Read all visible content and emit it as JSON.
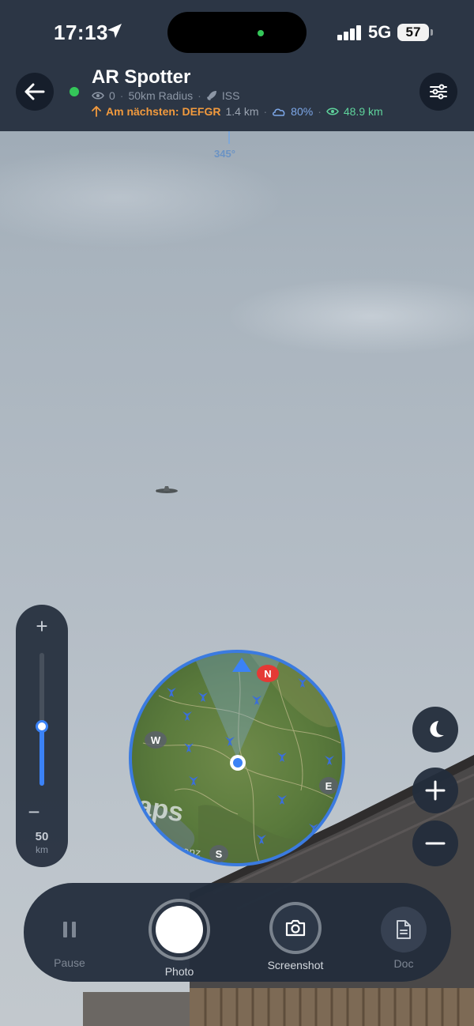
{
  "status_bar": {
    "time": "17:13",
    "network": "5G",
    "battery": "57"
  },
  "header": {
    "title": "AR Spotter",
    "viewer_count": "0",
    "radius": "50km Radius",
    "satellite": "ISS",
    "nearest_label": "Am nächsten: DEFGR",
    "nearest_distance": "1.4 km",
    "cloud_cover": "80%",
    "visibility": "48.9 km",
    "heading": "345°"
  },
  "zoom": {
    "plus": "+",
    "minus": "−",
    "value": "50",
    "unit": "km",
    "level": 0.45
  },
  "map": {
    "north": "N",
    "west": "W",
    "east": "E",
    "south": "S",
    "watermark": "aps",
    "place": "regenz"
  },
  "toolbar": {
    "pause_label": "Pause",
    "photo_label": "Photo",
    "screenshot_label": "Screenshot",
    "doc_label": "Doc"
  },
  "colors": {
    "accent": "#3b82f6",
    "nearest": "#f29a3d",
    "cloud": "#7da7e8",
    "visibility": "#5fd49c",
    "live": "#34c759",
    "north_badge": "#e53935"
  }
}
